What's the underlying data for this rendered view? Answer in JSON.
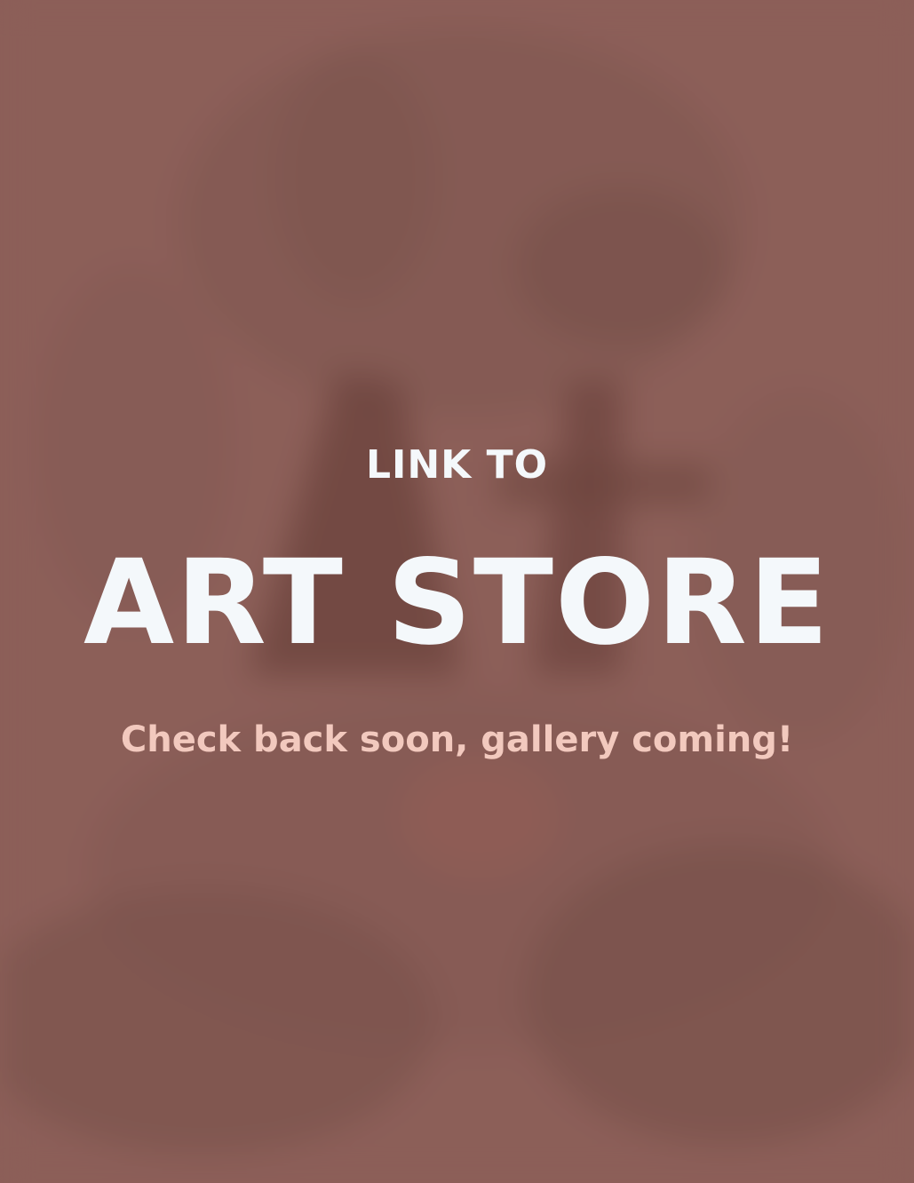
{
  "card": {
    "kicker": "LINK TO",
    "title": "ART STORE",
    "subtitle": "Check back soon, gallery coming!"
  },
  "colors": {
    "background": "#8c615a",
    "title_text": "#f4f8fb",
    "subtitle_text": "#f2c9be"
  }
}
